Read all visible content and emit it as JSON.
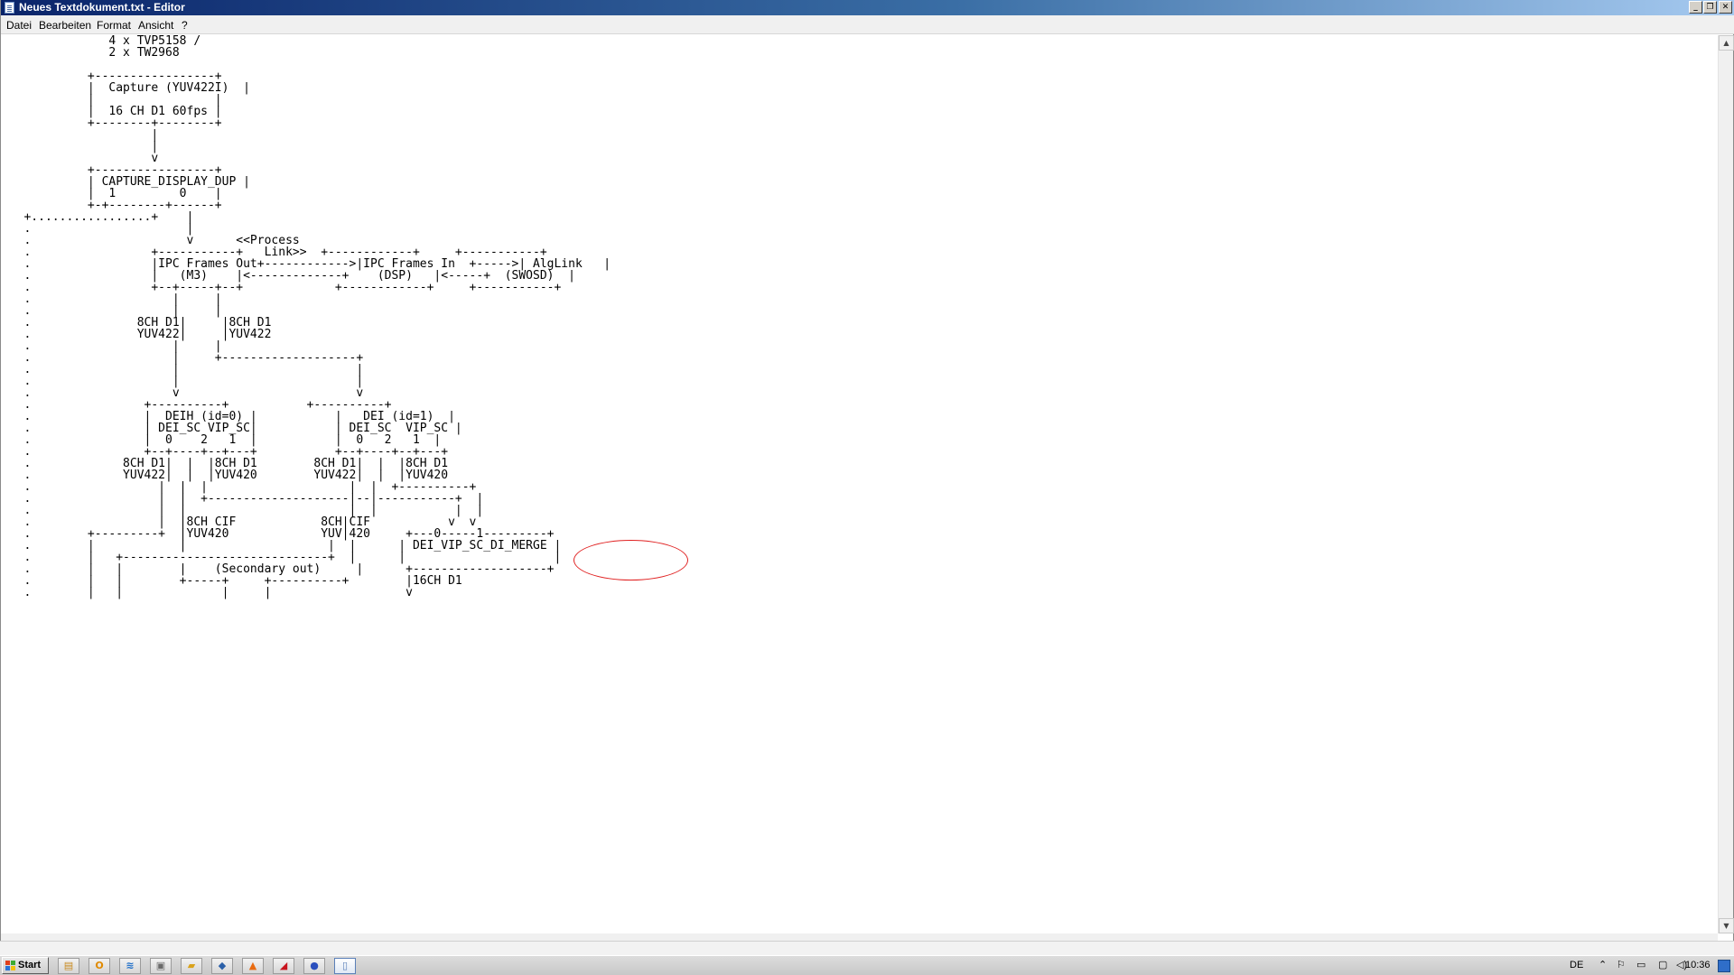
{
  "window": {
    "title": "Neues Textdokument.txt - Editor",
    "controls": [
      "_",
      "❐",
      "✕"
    ]
  },
  "menu": {
    "items": [
      "Datei",
      "Bearbeiten",
      "Format",
      "Ansicht",
      "?"
    ]
  },
  "editor": {
    "lines": [
      "               4 x TVP5158 /",
      "               2 x TW2968",
      "",
      "            +-----------------+",
      "            |  Capture (YUV422I)  |",
      "            |                 |",
      "            |  16 CH D1 60fps |",
      "            +--------+--------+",
      "                     |",
      "                     |",
      "                     v",
      "            +-----------------+",
      "            | CAPTURE_DISPLAY_DUP |",
      "            |  1         0    |",
      "            +-+--------+------+",
      "   +.................+    |",
      "   .                      |",
      "   .                      v      <<Process",
      "   .                 +-----------+   Link>>  +------------+     +-----------+",
      "   .                 |IPC Frames Out+------------>|IPC Frames In  +----->| AlgLink   |",
      "   .                 |   (M3)    |<-------------+    (DSP)   |<-----+  (SWOSD)  |",
      "   .                 +--+-----+--+             +------------+     +-----------+",
      "   .                    |     |",
      "   .                    |     |",
      "   .               8CH D1|     |8CH D1",
      "   .               YUV422|     |YUV422",
      "   .                    |     |",
      "   .                    |     +-------------------+",
      "   .                    |                         |",
      "   .                    |                         |",
      "   .                    v                         v",
      "   .                +----------+           +----------+",
      "   .                |  DEIH (id=0) |           |   DEI (id=1)  |",
      "   .                | DEI_SC VIP_SC|           | DEI_SC  VIP_SC |",
      "   .                |  0    2   1  |           |  0   2   1  |",
      "   .                +--+----+--+---+           +--+----+--+---+",
      "   .             8CH D1|  |  |8CH D1        8CH D1|  |  |8CH D1",
      "   .             YUV422|  |  |YUV420        YUV422|  |  |YUV420",
      "   .                  |  |  |                    |  |  +----------+",
      "   .                  |  |  +--------------------|--|-----------+  |",
      "   .                  |  |                       |  |           |  |",
      "   .                  |  |8CH CIF            8CH|CIF           v  v",
      "   .        +---------+  |YUV420             YUV|420     +---0-----1---------+",
      "   .        |            |                    |  |      | DEI_VIP_SC_DI_MERGE |",
      "   .        |   +-----------------------------+  |      |                     |",
      "   .        |   |        |    (Secondary out)     |      +-------------------+",
      "   .        |   |        +-----+     +----------+        |16CH D1",
      "   .        |   |              |     |                   v"
    ]
  },
  "taskbar": {
    "start_label": "Start",
    "icons": [
      "explorer-icon",
      "outlook-icon",
      "wifi-icon",
      "network-icon",
      "folder-icon",
      "virtualbox-icon",
      "vlc-icon",
      "acrobat-icon",
      "firefox-icon",
      "notepad-icon"
    ],
    "language": "DE",
    "clock": "10:36"
  }
}
